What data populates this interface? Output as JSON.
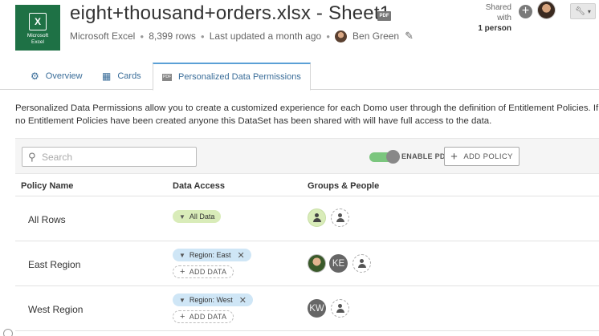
{
  "header": {
    "app_logo": {
      "line1": "Microsoft",
      "line2": "Excel",
      "glyph": "X"
    },
    "title": "eight+thousand+orders.xlsx - Sheet1",
    "pdf_badge": "PDF",
    "source": "Microsoft Excel",
    "rows": "8,399 rows",
    "updated": "Last updated a month ago",
    "owner": "Ben Green",
    "shared_with_label": "Shared with",
    "shared_with_count": "1 person"
  },
  "tabs": [
    {
      "label": "Overview",
      "icon": "gear-icon"
    },
    {
      "label": "Cards",
      "icon": "grid-icon"
    },
    {
      "label": "Personalized Data Permissions",
      "icon": "pdf-icon",
      "active": true
    }
  ],
  "description": "Personalized Data Permissions allow you to create a customized experience for each Domo user through the definition of Entitlement Policies. If no Entitlement Policies have been created anyone this DataSet has been shared with will have full access to the data.",
  "toolbar": {
    "search_placeholder": "Search",
    "toggle_label": "ENABLE PD",
    "toggle_on": true,
    "add_policy_label": "ADD POLICY"
  },
  "table": {
    "columns": [
      "Policy Name",
      "Data Access",
      "Groups & People"
    ],
    "add_data_label": "ADD DATA",
    "rows": [
      {
        "name": "All Rows",
        "access": [
          "All Data"
        ],
        "people": [
          "group",
          "add"
        ]
      },
      {
        "name": "East Region",
        "access": [
          "Region: East"
        ],
        "people": [
          "photo",
          "KE",
          "add"
        ]
      },
      {
        "name": "West Region",
        "access": [
          "Region: West"
        ],
        "people": [
          "KW",
          "add"
        ]
      }
    ]
  },
  "colors": {
    "excel_green": "#1e7145",
    "link_blue": "#3a6d99",
    "active_tab_accent": "#5aa0d6",
    "toggle_on": "#7bc67e",
    "all_data_pill": "#d9ecb9",
    "region_pill": "#cfe6f6"
  }
}
